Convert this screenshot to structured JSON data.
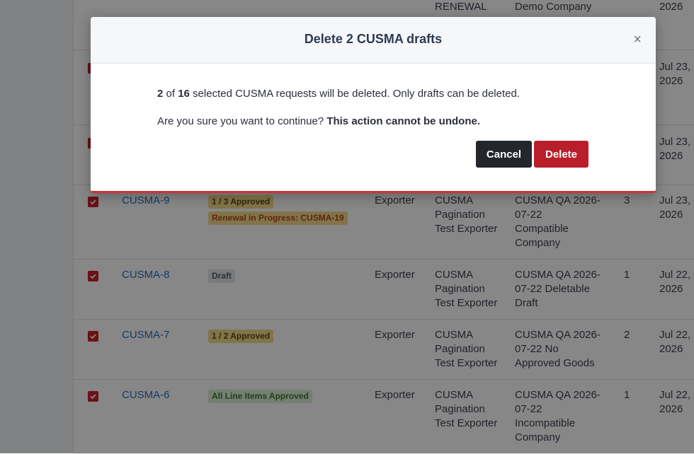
{
  "top_row": {
    "type": "RENEWAL",
    "company": "Demo Company",
    "date": "2026"
  },
  "partial_rows": [
    {
      "date1": "Jul 23,",
      "date2": "2026"
    },
    {
      "date1": "Jul 23,",
      "date2": "2026"
    }
  ],
  "rows": [
    {
      "id": "CUSMA-9",
      "badges": [
        {
          "text": "1 / 3 Approved",
          "style": "yellow"
        },
        {
          "text": "Renewal in Progress: CUSMA-19",
          "style": "orange"
        }
      ],
      "role": "Exporter",
      "exporter": [
        "CUSMA",
        "Pagination",
        "Test Exporter"
      ],
      "company": [
        "CUSMA QA 2026-",
        "07-22",
        "Compatible",
        "Company"
      ],
      "count": "3",
      "date": [
        "Jul 23,",
        "2026"
      ]
    },
    {
      "id": "CUSMA-8",
      "badges": [
        {
          "text": "Draft",
          "style": "gray"
        }
      ],
      "role": "Exporter",
      "exporter": [
        "CUSMA",
        "Pagination",
        "Test Exporter"
      ],
      "company": [
        "CUSMA QA 2026-",
        "07-22 Deletable",
        "Draft"
      ],
      "count": "1",
      "date": [
        "Jul 22,",
        "2026"
      ]
    },
    {
      "id": "CUSMA-7",
      "badges": [
        {
          "text": "1 / 2 Approved",
          "style": "yellow"
        }
      ],
      "role": "Exporter",
      "exporter": [
        "CUSMA",
        "Pagination",
        "Test Exporter"
      ],
      "company": [
        "CUSMA QA 2026-",
        "07-22 No",
        "Approved Goods"
      ],
      "count": "2",
      "date": [
        "Jul 22,",
        "2026"
      ]
    },
    {
      "id": "CUSMA-6",
      "badges": [
        {
          "text": "All Line Items Approved",
          "style": "green"
        }
      ],
      "role": "Exporter",
      "exporter": [
        "CUSMA",
        "Pagination",
        "Test Exporter"
      ],
      "company": [
        "CUSMA QA 2026-",
        "07-22",
        "Incompatible",
        "Company"
      ],
      "count": "1",
      "date": [
        "Jul 22,",
        "2026"
      ]
    }
  ],
  "modal": {
    "title": "Delete 2 CUSMA drafts",
    "close_glyph": "×",
    "msg_count": "2",
    "msg_of": " of ",
    "msg_total": "16",
    "msg_rest": " selected CUSMA requests will be deleted. Only drafts can be deleted.",
    "confirm_text": "Are you sure you want to continue? ",
    "warning_text": "This action cannot be undone.",
    "cancel_label": "Cancel",
    "delete_label": "Delete"
  },
  "colors": {
    "primary_red": "#b81f2b",
    "link_blue": "#2b6cc4",
    "dark_button": "#23262b"
  }
}
